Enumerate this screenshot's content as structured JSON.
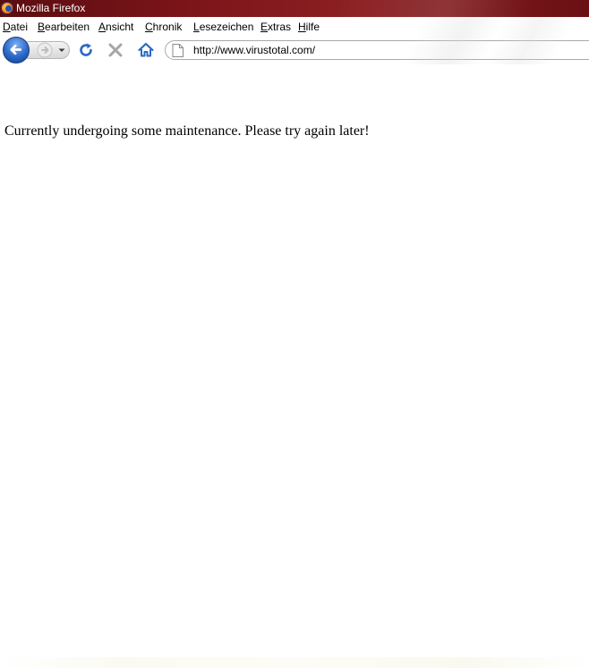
{
  "window": {
    "title": "Mozilla Firefox"
  },
  "menu": {
    "items": [
      {
        "accel": "D",
        "rest": "atei"
      },
      {
        "accel": "B",
        "rest": "earbeiten"
      },
      {
        "accel": "A",
        "rest": "nsicht"
      },
      {
        "accel": "C",
        "rest": "hronik"
      },
      {
        "accel": "L",
        "rest": "esezeichen"
      },
      {
        "accel": "E",
        "rest": "xtras"
      },
      {
        "accel": "H",
        "rest": "ilfe"
      }
    ]
  },
  "navigation": {
    "url": "http://www.virustotal.com/",
    "icons": {
      "back": "back-arrow-icon",
      "forward": "forward-arrow-icon",
      "history": "chevron-down-icon",
      "reload": "reload-icon",
      "stop": "stop-icon",
      "home": "home-icon",
      "favicon": "blank-page-icon"
    }
  },
  "page": {
    "message": "Currently undergoing some maintenance. Please try again later!"
  },
  "colors": {
    "titlebar": "#7a1419",
    "accent_blue": "#2a68c8",
    "stop_gray": "#9a9a9a"
  }
}
